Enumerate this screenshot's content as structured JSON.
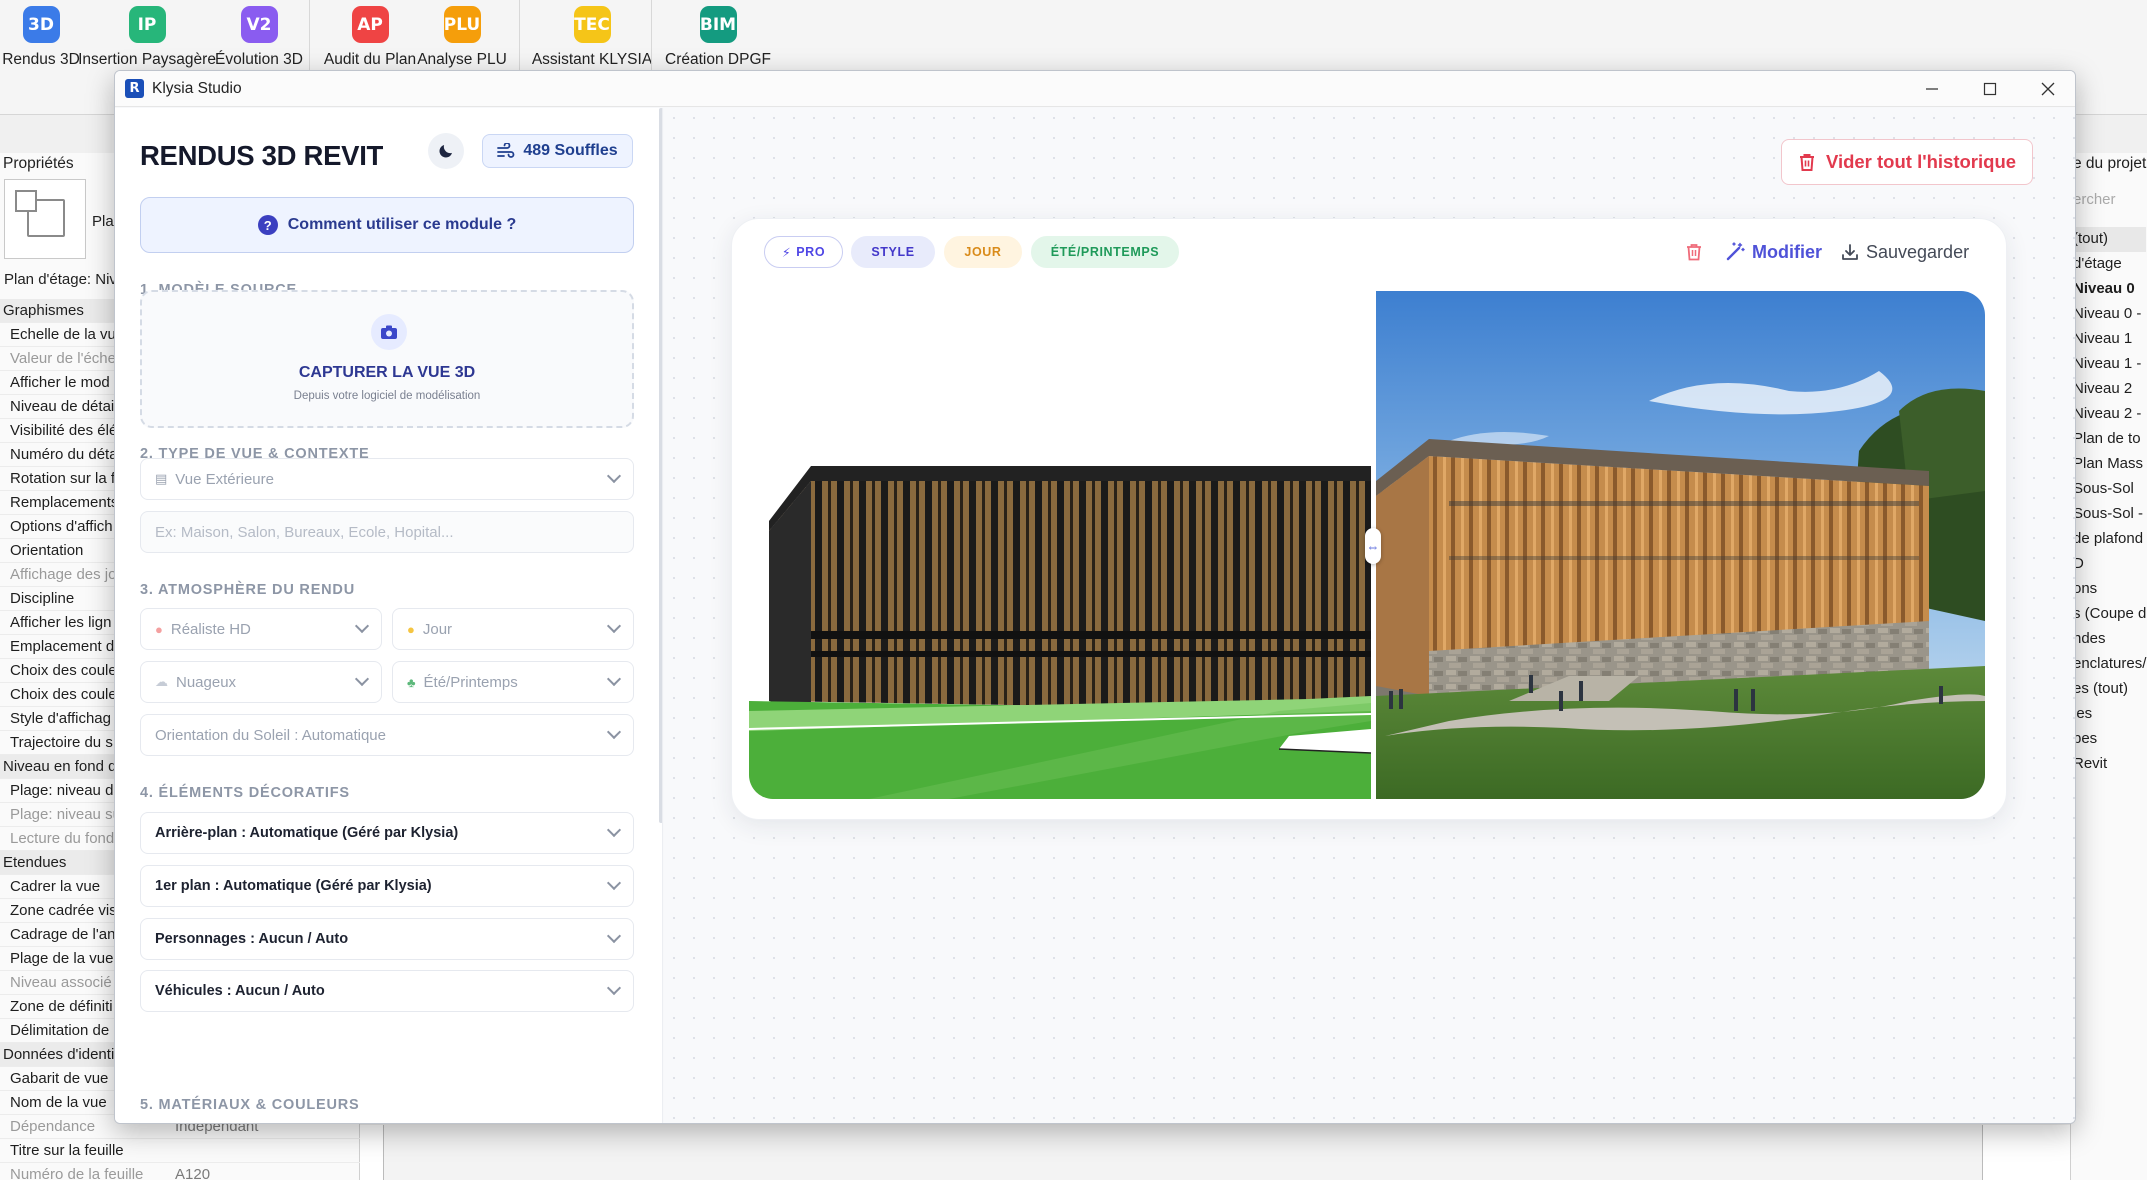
{
  "ribbon": {
    "buttons": [
      {
        "abbr": "3D",
        "label": "Rendus 3D",
        "color": "#3b7be8"
      },
      {
        "abbr": "IP",
        "label": "Insertion Paysagère",
        "color": "#27b67a"
      },
      {
        "abbr": "V2",
        "label": "Évolution 3D",
        "color": "#8a5cf0"
      },
      {
        "abbr": "AP",
        "label": "Audit du Plan",
        "color": "#ef4444"
      },
      {
        "abbr": "PLU",
        "label": "Analyse PLU",
        "color": "#f59e0b"
      },
      {
        "abbr": "TEC",
        "label": "Assistant KLYSIA",
        "color": "#f5c518"
      },
      {
        "abbr": "BIM",
        "label": "Création DPGF",
        "color": "#149b80"
      }
    ]
  },
  "properties": {
    "title": "Propriétés",
    "type_name": "Plan",
    "view_type": "Plan d'étage: Niv",
    "rows": [
      {
        "label": "Graphismes",
        "kind": "cat"
      },
      {
        "label": "Echelle de la vu",
        "kind": "item"
      },
      {
        "label": "Valeur de l'éche",
        "kind": "grey"
      },
      {
        "label": "Afficher le mod",
        "kind": "item"
      },
      {
        "label": "Niveau de détai",
        "kind": "item"
      },
      {
        "label": "Visibilité des élé",
        "kind": "item"
      },
      {
        "label": "Numéro du déta",
        "kind": "item"
      },
      {
        "label": "Rotation sur la f",
        "kind": "item"
      },
      {
        "label": "Remplacements",
        "kind": "item"
      },
      {
        "label": "Options d'affich",
        "kind": "item"
      },
      {
        "label": "Orientation",
        "kind": "item"
      },
      {
        "label": "Affichage des jo",
        "kind": "grey"
      },
      {
        "label": "Discipline",
        "kind": "item"
      },
      {
        "label": "Afficher les lign",
        "kind": "item"
      },
      {
        "label": "Emplacement d",
        "kind": "item"
      },
      {
        "label": "Choix des coule",
        "kind": "item"
      },
      {
        "label": "Choix des coule",
        "kind": "item"
      },
      {
        "label": "Style d'affichag",
        "kind": "item"
      },
      {
        "label": "Trajectoire du s",
        "kind": "item"
      },
      {
        "label": "Niveau en fond d",
        "kind": "cat2"
      },
      {
        "label": "Plage: niveau de",
        "kind": "item"
      },
      {
        "label": "Plage: niveau su",
        "kind": "grey"
      },
      {
        "label": "Lecture du fond",
        "kind": "grey"
      },
      {
        "label": "Etendues",
        "kind": "cat"
      },
      {
        "label": "Cadrer la vue",
        "kind": "item"
      },
      {
        "label": "Zone cadrée vis",
        "kind": "item"
      },
      {
        "label": "Cadrage de l'an",
        "kind": "item"
      },
      {
        "label": "Plage de la vue",
        "kind": "item"
      },
      {
        "label": "Niveau associé",
        "kind": "grey"
      },
      {
        "label": "Zone de définiti",
        "kind": "item"
      },
      {
        "label": "Délimitation de",
        "kind": "item"
      },
      {
        "label": "Données d'identi",
        "kind": "cat"
      },
      {
        "label": "Gabarit de vue",
        "kind": "item"
      },
      {
        "label": "Nom de la vue",
        "kind": "item"
      },
      {
        "label": "Dépendance",
        "kind": "grey",
        "value": "Indépendant"
      },
      {
        "label": "Titre sur la feuille",
        "kind": "item"
      },
      {
        "label": "Numéro de la feuille",
        "kind": "grey",
        "value": "A120"
      }
    ]
  },
  "browser": {
    "title": "e du projet",
    "search_placeholder": "ercher",
    "items": [
      {
        "label": "(tout)",
        "bold": false
      },
      {
        "label": "d'étage",
        "bold": false
      },
      {
        "label": "Niveau 0",
        "bold": true
      },
      {
        "label": "Niveau 0 -",
        "bold": false
      },
      {
        "label": "Niveau 1",
        "bold": false
      },
      {
        "label": "Niveau 1 -",
        "bold": false
      },
      {
        "label": "Niveau 2",
        "bold": false
      },
      {
        "label": "Niveau 2 -",
        "bold": false
      },
      {
        "label": "Plan de to",
        "bold": false
      },
      {
        "label": "Plan Mass",
        "bold": false
      },
      {
        "label": "Sous-Sol",
        "bold": false
      },
      {
        "label": "Sous-Sol -",
        "bold": false
      },
      {
        "label": "de plafond",
        "bold": false
      },
      {
        "label": "D",
        "bold": false
      },
      {
        "label": "ons",
        "bold": false
      },
      {
        "label": "s (Coupe d",
        "bold": false
      },
      {
        "label": "ndes",
        "bold": false
      },
      {
        "label": "enclatures/",
        "bold": false
      },
      {
        "label": "es (tout)",
        "bold": false
      },
      {
        "label": "les",
        "bold": false
      },
      {
        "label": "pes",
        "bold": false
      },
      {
        "label": "Revit",
        "bold": false
      }
    ]
  },
  "window": {
    "title": "Klysia Studio",
    "logo_letter": "R"
  },
  "panel": {
    "title": "RENDUS 3D REVIT",
    "credits": "489 Souffles",
    "help": "Comment utiliser ce module ?",
    "sections": {
      "s1": "1. MODÈLE SOURCE",
      "s2": "2. TYPE DE VUE & CONTEXTE",
      "s3": "3. ATMOSPHÈRE DU RENDU",
      "s4": "4. ÉLÉMENTS DÉCORATIFS",
      "s5": "5. MATÉRIAUX & COULEURS"
    },
    "capture": {
      "title": "CAPTURER LA VUE 3D",
      "subtitle": "Depuis votre logiciel de modélisation"
    },
    "view_type": "Vue Extérieure",
    "context_placeholder": "Ex: Maison, Salon, Bureaux, Ecole, Hopital...",
    "atmosphere": {
      "style": "Réaliste HD",
      "time": "Jour",
      "weather": "Nuageux",
      "season": "Été/Printemps",
      "sun": "Orientation du Soleil : Automatique"
    },
    "decor": {
      "background": "Arrière-plan : Automatique (Géré par Klysia)",
      "foreground": "1er plan : Automatique (Géré par Klysia)",
      "people": "Personnages : Aucun / Auto",
      "vehicles": "Véhicules : Aucun / Auto"
    }
  },
  "main": {
    "clear_history": "Vider tout l'historique",
    "tags": [
      {
        "label": "PRO",
        "fg": "#4f46e5",
        "bg": "#ffffff",
        "border": "#c9cdf2"
      },
      {
        "label": "STYLE",
        "fg": "#4338ca",
        "bg": "#e8ebfb",
        "border": "#e8ebfb"
      },
      {
        "label": "JOUR",
        "fg": "#d98b1a",
        "bg": "#fff4e0",
        "border": "#fff4e0"
      },
      {
        "label": "ÉTÉ/PRINTEMPS",
        "fg": "#1f9a5a",
        "bg": "#e3f6ea",
        "border": "#e3f6ea"
      }
    ],
    "actions": {
      "edit": "Modifier",
      "save": "Sauvegarder"
    }
  }
}
